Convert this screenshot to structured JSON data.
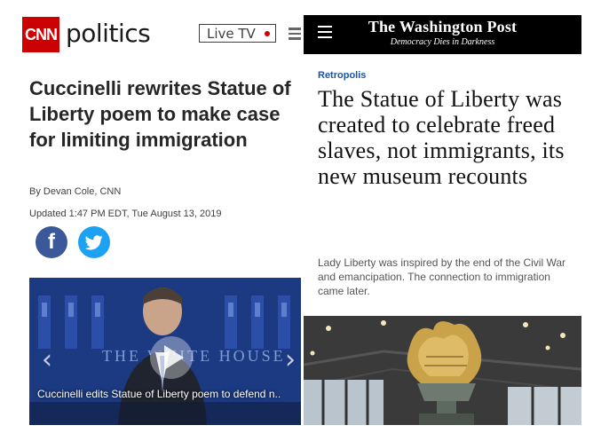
{
  "cnn": {
    "logo": "CNN",
    "section": "politics",
    "live_tv_label": "Live TV",
    "headline": "Cuccinelli rewrites Statue of Liberty poem to make case for limiting immigration",
    "byline": "By Devan Cole, CNN",
    "updated": "Updated 1:47 PM EDT, Tue August 13, 2019",
    "share_facebook": "f",
    "video_caption": "Cuccinelli edits Statue of Liberty poem to defend n..",
    "video_backdrop_text": "THE WHITE HOUSE",
    "colors": {
      "brand": "#cc0000",
      "facebook": "#3b5998",
      "twitter": "#1da1f2"
    }
  },
  "wapo": {
    "masthead": "The Washington Post",
    "tagline": "Democracy Dies in Darkness",
    "kicker": "Retropolis",
    "headline": "The Statue of Liberty was created to celebrate freed slaves, not immigrants, its new museum recounts",
    "dek": "Lady Liberty was inspired by the end of the Civil War and emancipation. The connection to immigration came later.",
    "colors": {
      "header": "#000000",
      "kicker": "#1955a5"
    }
  }
}
